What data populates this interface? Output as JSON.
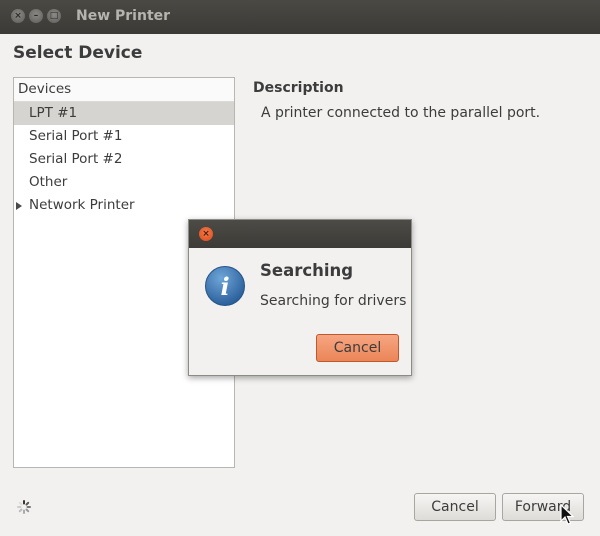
{
  "window": {
    "title": "New Printer",
    "heading": "Select Device"
  },
  "devices": {
    "header": "Devices",
    "items": [
      {
        "label": "LPT #1",
        "selected": true
      },
      {
        "label": "Serial Port #1"
      },
      {
        "label": "Serial Port #2"
      },
      {
        "label": "Other"
      },
      {
        "label": "Network Printer",
        "expandable": true
      }
    ]
  },
  "description": {
    "title": "Description",
    "text": "A printer connected to the parallel port."
  },
  "buttons": {
    "cancel": "Cancel",
    "forward": "Forward"
  },
  "dialog": {
    "title": "Searching",
    "message": "Searching for drivers",
    "cancel": "Cancel"
  },
  "colors": {
    "accent": "#eb8558",
    "titlebar": "#3c3b37"
  }
}
